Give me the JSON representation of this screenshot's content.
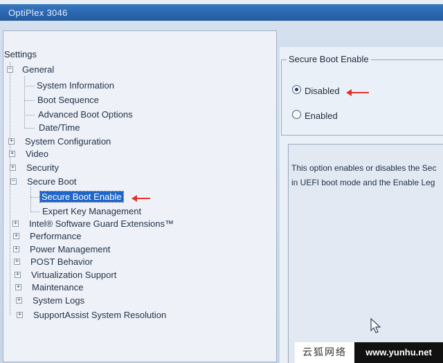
{
  "window": {
    "title": "OptiPlex 3046"
  },
  "tree": {
    "root_label": "Settings",
    "nodes": [
      {
        "label": "General",
        "expander": "−"
      },
      {
        "label": "System Information"
      },
      {
        "label": "Boot Sequence"
      },
      {
        "label": "Advanced Boot Options"
      },
      {
        "label": "Date/Time"
      },
      {
        "label": "System Configuration",
        "expander": "+"
      },
      {
        "label": "Video",
        "expander": "+"
      },
      {
        "label": "Security",
        "expander": "+"
      },
      {
        "label": "Secure Boot",
        "expander": "−"
      },
      {
        "label": "Secure Boot Enable",
        "selected": true
      },
      {
        "label": "Expert Key Management"
      },
      {
        "label": "Intel® Software Guard Extensions™",
        "expander": "+"
      },
      {
        "label": "Performance",
        "expander": "+"
      },
      {
        "label": "Power Management",
        "expander": "+"
      },
      {
        "label": "POST Behavior",
        "expander": "+"
      },
      {
        "label": "Virtualization Support",
        "expander": "+"
      },
      {
        "label": "Maintenance",
        "expander": "+"
      },
      {
        "label": "System Logs",
        "expander": "+"
      },
      {
        "label": "SupportAssist System Resolution",
        "expander": "+"
      }
    ]
  },
  "detail": {
    "group_title": "Secure Boot Enable",
    "options": [
      {
        "label": "Disabled",
        "selected": true
      },
      {
        "label": "Enabled",
        "selected": false
      }
    ],
    "description_lines": [
      "This option enables or disables the Sec",
      "in UEFI boot mode and the Enable Leg"
    ]
  },
  "watermark": {
    "left_text": "云狐网络",
    "right_text": "www.yunhu.net"
  },
  "colors": {
    "selection": "#1f66c9",
    "annotation_arrow": "#e0322b",
    "titlebar": "#2a67b0"
  }
}
